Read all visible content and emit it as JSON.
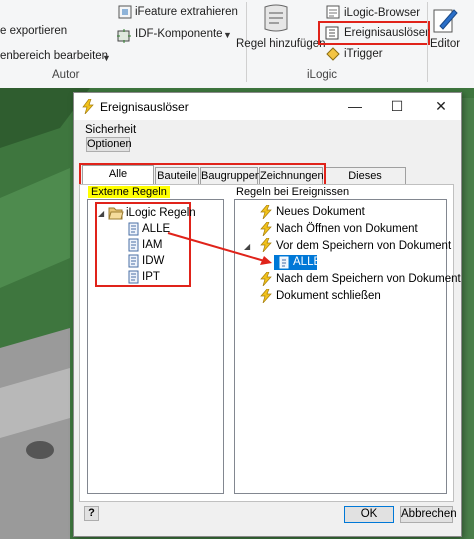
{
  "ribbon": {
    "export_label": "e exportieren",
    "edit_area_label": "enbereich bearbeiten",
    "ifeature_label": "iFeature extrahieren",
    "idf_label": "IDF-Komponente",
    "regel_label": "Regel hinzufügen",
    "ilogic_browser_label": "iLogic-Browser",
    "ereignis_label": "Ereignisauslöser",
    "itrigger_label": "iTrigger",
    "editor_label": "Editor",
    "group_autor": "Autor",
    "group_ilogic": "iLogic"
  },
  "dialog": {
    "title": "Ereignisauslöser",
    "minimize": "—",
    "maximize": "☐",
    "close": "✕",
    "sicherheit_label": "Sicherheit",
    "optionen_button": "Optionen",
    "tabs": [
      "Alle Dokumente",
      "Bauteile",
      "Baugruppen",
      "Zeichnungen",
      "Dieses Dokument"
    ],
    "externe_regeln_label": "Externe Regeln",
    "regeln_ereignisse_label": "Regeln bei Ereignissen",
    "left_tree": {
      "root": "iLogic Regeln",
      "items": [
        "ALLE",
        "IAM",
        "IDW",
        "IPT"
      ]
    },
    "right_tree": {
      "items": [
        "Neues Dokument",
        "Nach Öffnen von Dokument",
        "Vor dem Speichern von Dokument",
        "Nach dem Speichern von Dokument",
        "Dokument schließen"
      ],
      "child": "ALLE"
    },
    "help_button": "?",
    "ok_button": "OK",
    "cancel_button": "Abbrechen"
  },
  "colors": {
    "highlight_red": "#e0231a",
    "yellow_highlight": "#ffff00",
    "selection_blue": "#0078d7",
    "model_green": "#3c6e3c"
  }
}
